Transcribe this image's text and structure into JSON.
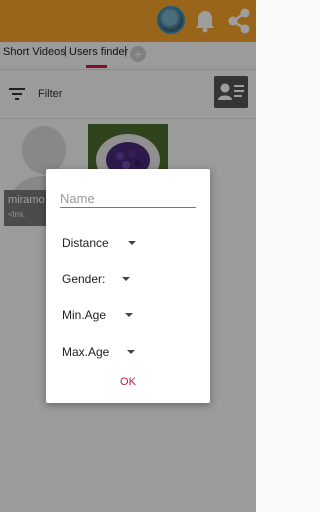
{
  "tabs": [
    {
      "label": "Short Videos"
    },
    {
      "label": "Users finder"
    }
  ],
  "filter": {
    "label": "Filter"
  },
  "grid": {
    "user_card": {
      "name": "miramo",
      "distance": "<lmi."
    }
  },
  "dialog": {
    "name_placeholder": "Name",
    "fields": [
      {
        "label": "Distance"
      },
      {
        "label": "Gender:"
      },
      {
        "label": "Min.Age"
      },
      {
        "label": "Max.Age"
      }
    ],
    "ok_label": "OK"
  },
  "colors": {
    "app_bar": "#f7a32a",
    "accent": "#d4184a"
  },
  "icons": [
    "avatar",
    "bell-icon",
    "share-icon",
    "add-tab-icon",
    "filter-icon",
    "contact-card-icon",
    "dropdown-caret-icon"
  ]
}
